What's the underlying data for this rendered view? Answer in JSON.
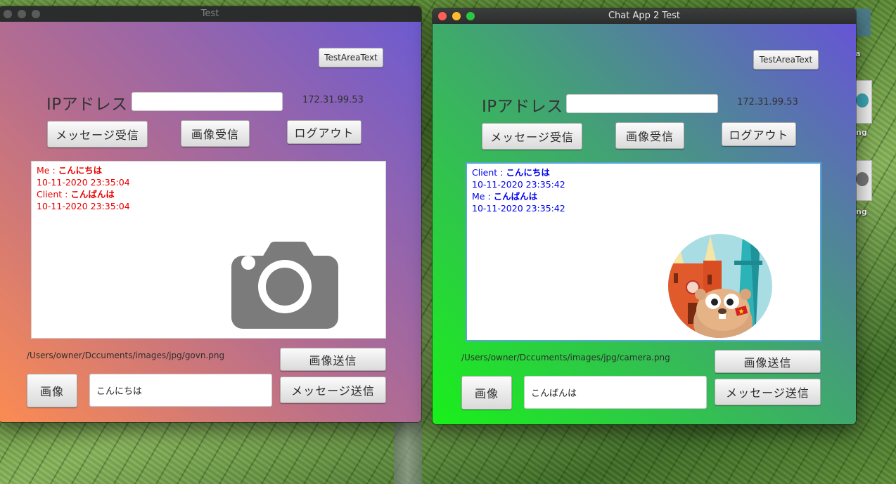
{
  "colors": {
    "win1_msg_text": "#e80000",
    "win2_msg_text": "#0000ee"
  },
  "window1": {
    "title": "Test",
    "test_area_button": "TestAreaText",
    "ip_label": "IPアドレス",
    "ip_input": "",
    "ip_value": "172.31.99.53",
    "receive_message_button": "メッセージ受信",
    "receive_image_button": "画像受信",
    "logout_button": "ログアウト",
    "messages": [
      {
        "sender": "Me : ",
        "text": "こんにちは",
        "time": "10-11-2020 23:35:04"
      },
      {
        "sender": "Client : ",
        "text": "こんばんは",
        "time": "10-11-2020 23:35:04"
      }
    ],
    "image_icon": "camera-icon",
    "file_path": "/Users/owner/Dccuments/images/jpg/govn.png",
    "send_image_button": "画像送信",
    "image_button": "画像",
    "message_input": "こんにちは",
    "send_message_button": "メッセージ送信"
  },
  "window2": {
    "title": "Chat App 2 Test",
    "test_area_button": "TestAreaText",
    "ip_label": "IPアドレス",
    "ip_input": "",
    "ip_value": "172.31.99.53",
    "receive_message_button": "メッセージ受信",
    "receive_image_button": "画像受信",
    "logout_button": "ログアウト",
    "messages": [
      {
        "sender": "Client : ",
        "text": "こんにちは",
        "time": "10-11-2020 23:35:42"
      },
      {
        "sender": "Me : ",
        "text": "こんばんは",
        "time": "10-11-2020 23:35:42"
      }
    ],
    "image_icon": "gopher-vietnam-illustration",
    "file_path": "/Users/owner/Dccuments/images/jpg/camera.png",
    "send_image_button": "画像送信",
    "image_button": "画像",
    "message_input": "こんばんは",
    "send_message_button": "メッセージ送信"
  },
  "desktop": {
    "icon_label_1": "ng",
    "icon_label_2": "ng",
    "icon_label_0": "a"
  }
}
